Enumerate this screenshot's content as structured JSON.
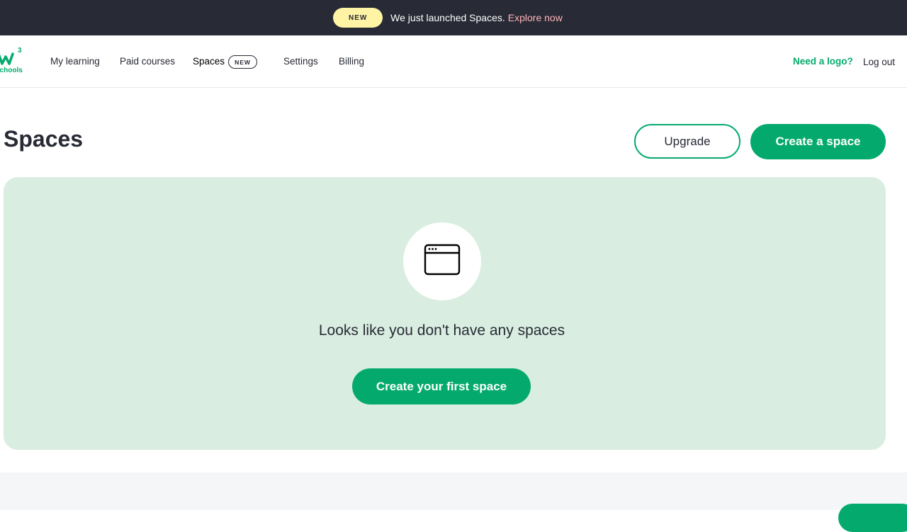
{
  "announcement": {
    "badge": "NEW",
    "text": "We just launched Spaces.",
    "link": "Explore now"
  },
  "nav": {
    "logo_icon": "w3schools-logo-icon",
    "items": [
      {
        "label": "My learning"
      },
      {
        "label": "Paid courses"
      },
      {
        "label": "Spaces",
        "badge": "NEW",
        "active": true
      },
      {
        "label": "Settings"
      },
      {
        "label": "Billing"
      }
    ],
    "need_logo": "Need a logo?",
    "logout": "Log out"
  },
  "page": {
    "title": "Spaces",
    "upgrade_label": "Upgrade",
    "create_label": "Create a space"
  },
  "empty_state": {
    "icon": "browser-window-icon",
    "message": "Looks like you don't have any spaces",
    "button_label": "Create your first space"
  },
  "colors": {
    "brand_green": "#04aa6d",
    "dark": "#282a35",
    "announce_badge": "#fff4a3",
    "announce_link": "#ffb3bb",
    "panel_bg": "#d9eee1"
  }
}
